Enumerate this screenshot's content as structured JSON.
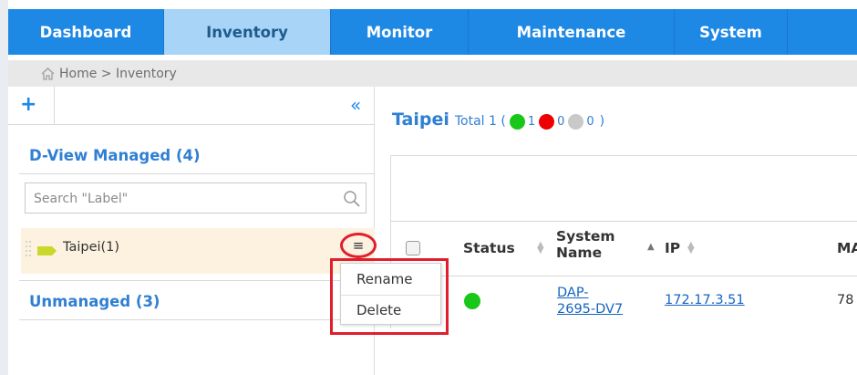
{
  "nav": {
    "tabs": [
      {
        "label": "Dashboard",
        "active": false
      },
      {
        "label": "Inventory",
        "active": true
      },
      {
        "label": "Monitor",
        "active": false
      },
      {
        "label": "Maintenance",
        "active": false
      },
      {
        "label": "System",
        "active": false
      }
    ]
  },
  "breadcrumb": {
    "icon": "home-icon",
    "text": "Home > Inventory"
  },
  "left_panel": {
    "add_label": "+",
    "collapse_label": "«",
    "managed_heading": "D-View Managed (4)",
    "search_placeholder": "Search \"Label\"",
    "label_item": "Taipei(1)",
    "menu_glyph": "≡",
    "unmanaged_heading": "Unmanaged (3)"
  },
  "context_menu": {
    "rename": "Rename",
    "delete": "Delete"
  },
  "right_panel": {
    "title": "Taipei",
    "total_label": "Total 1 (",
    "online": "1",
    "offline": "0",
    "unknown": "0",
    "close_paren": ")"
  },
  "table": {
    "headers": {
      "status": "Status",
      "system_name_1": "System",
      "system_name_2": "Name",
      "ip": "IP",
      "mac": "MA"
    },
    "row": {
      "name_1": "DAP-",
      "name_2": "2695-DV7",
      "ip": "172.17.3.51",
      "mac": "78"
    }
  },
  "colors": {
    "nav_blue": "#1e88e5",
    "nav_active": "#a7d4f7",
    "accent": "#2f7fd3",
    "highlight_red": "#e01e2d",
    "online_green": "#18c718"
  }
}
